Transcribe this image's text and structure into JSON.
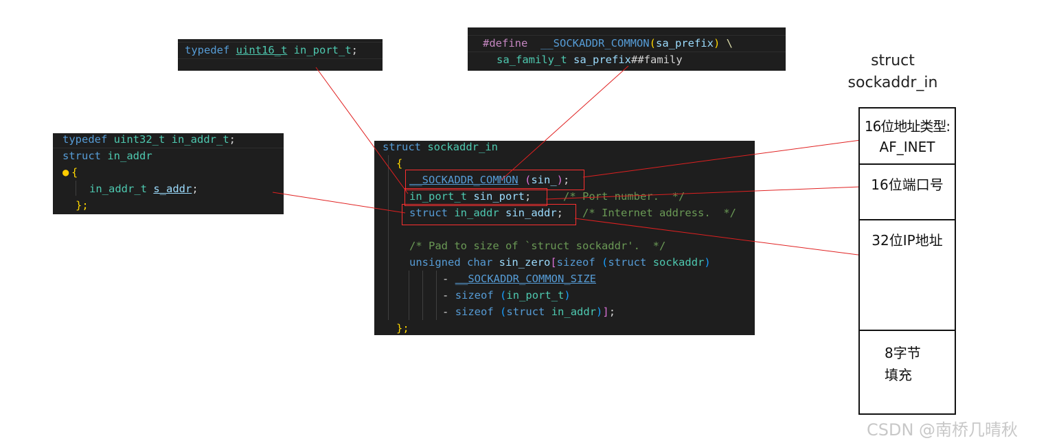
{
  "snippet_port": {
    "tokens": [
      "typedef",
      "uint16_t",
      "in_port_t",
      ";"
    ]
  },
  "snippet_define": {
    "line1": [
      "#define",
      "__SOCKADDR_COMMON",
      "(",
      "sa_prefix",
      ")",
      "\\"
    ],
    "line2": [
      "sa_family_t",
      "sa_prefix",
      "##family"
    ]
  },
  "snippet_addr": {
    "line1": [
      "typedef",
      "uint32_t",
      "in_addr_t",
      ";"
    ],
    "line2": [
      "struct",
      "in_addr"
    ],
    "line3": "{",
    "line4": [
      "in_addr_t",
      "s_addr",
      ";"
    ],
    "line5": "};"
  },
  "snippet_main": {
    "l1": [
      "struct",
      "sockaddr_in"
    ],
    "l2": "{",
    "l3": [
      "__SOCKADDR_COMMON",
      "(",
      "sin_",
      ")",
      ";"
    ],
    "l4": [
      "in_port_t",
      "sin_port",
      ";",
      "/* Port number.  */"
    ],
    "l5": [
      "struct",
      "in_addr",
      "sin_addr",
      ";",
      "/* Internet address.  */"
    ],
    "l6": "/* Pad to size of `struct sockaddr'.  */",
    "l7": [
      "unsigned",
      "char",
      "sin_zero",
      "[",
      "sizeof",
      "(",
      "struct",
      "sockaddr",
      ")"
    ],
    "l8": [
      "-",
      "__SOCKADDR_COMMON_SIZE"
    ],
    "l9": [
      "-",
      "sizeof",
      "(",
      "in_port_t",
      ")"
    ],
    "l10": [
      "-",
      "sizeof",
      "(",
      "struct",
      "in_addr",
      ")",
      "]",
      ";"
    ],
    "l11": "};"
  },
  "layout_diagram": {
    "title_line1": "struct",
    "title_line2": "sockaddr_in",
    "cells": [
      {
        "line1": "16位地址类型:",
        "line2": "AF_INET"
      },
      {
        "line1": "16位端口号",
        "line2": ""
      },
      {
        "line1": "32位IP地址",
        "line2": ""
      },
      {
        "line1": "8字节",
        "line2": "填充"
      }
    ]
  },
  "colors": {
    "connector": "#e02020",
    "editor_bg": "#1e1e1e"
  },
  "watermark": "CSDN @南桥几晴秋"
}
